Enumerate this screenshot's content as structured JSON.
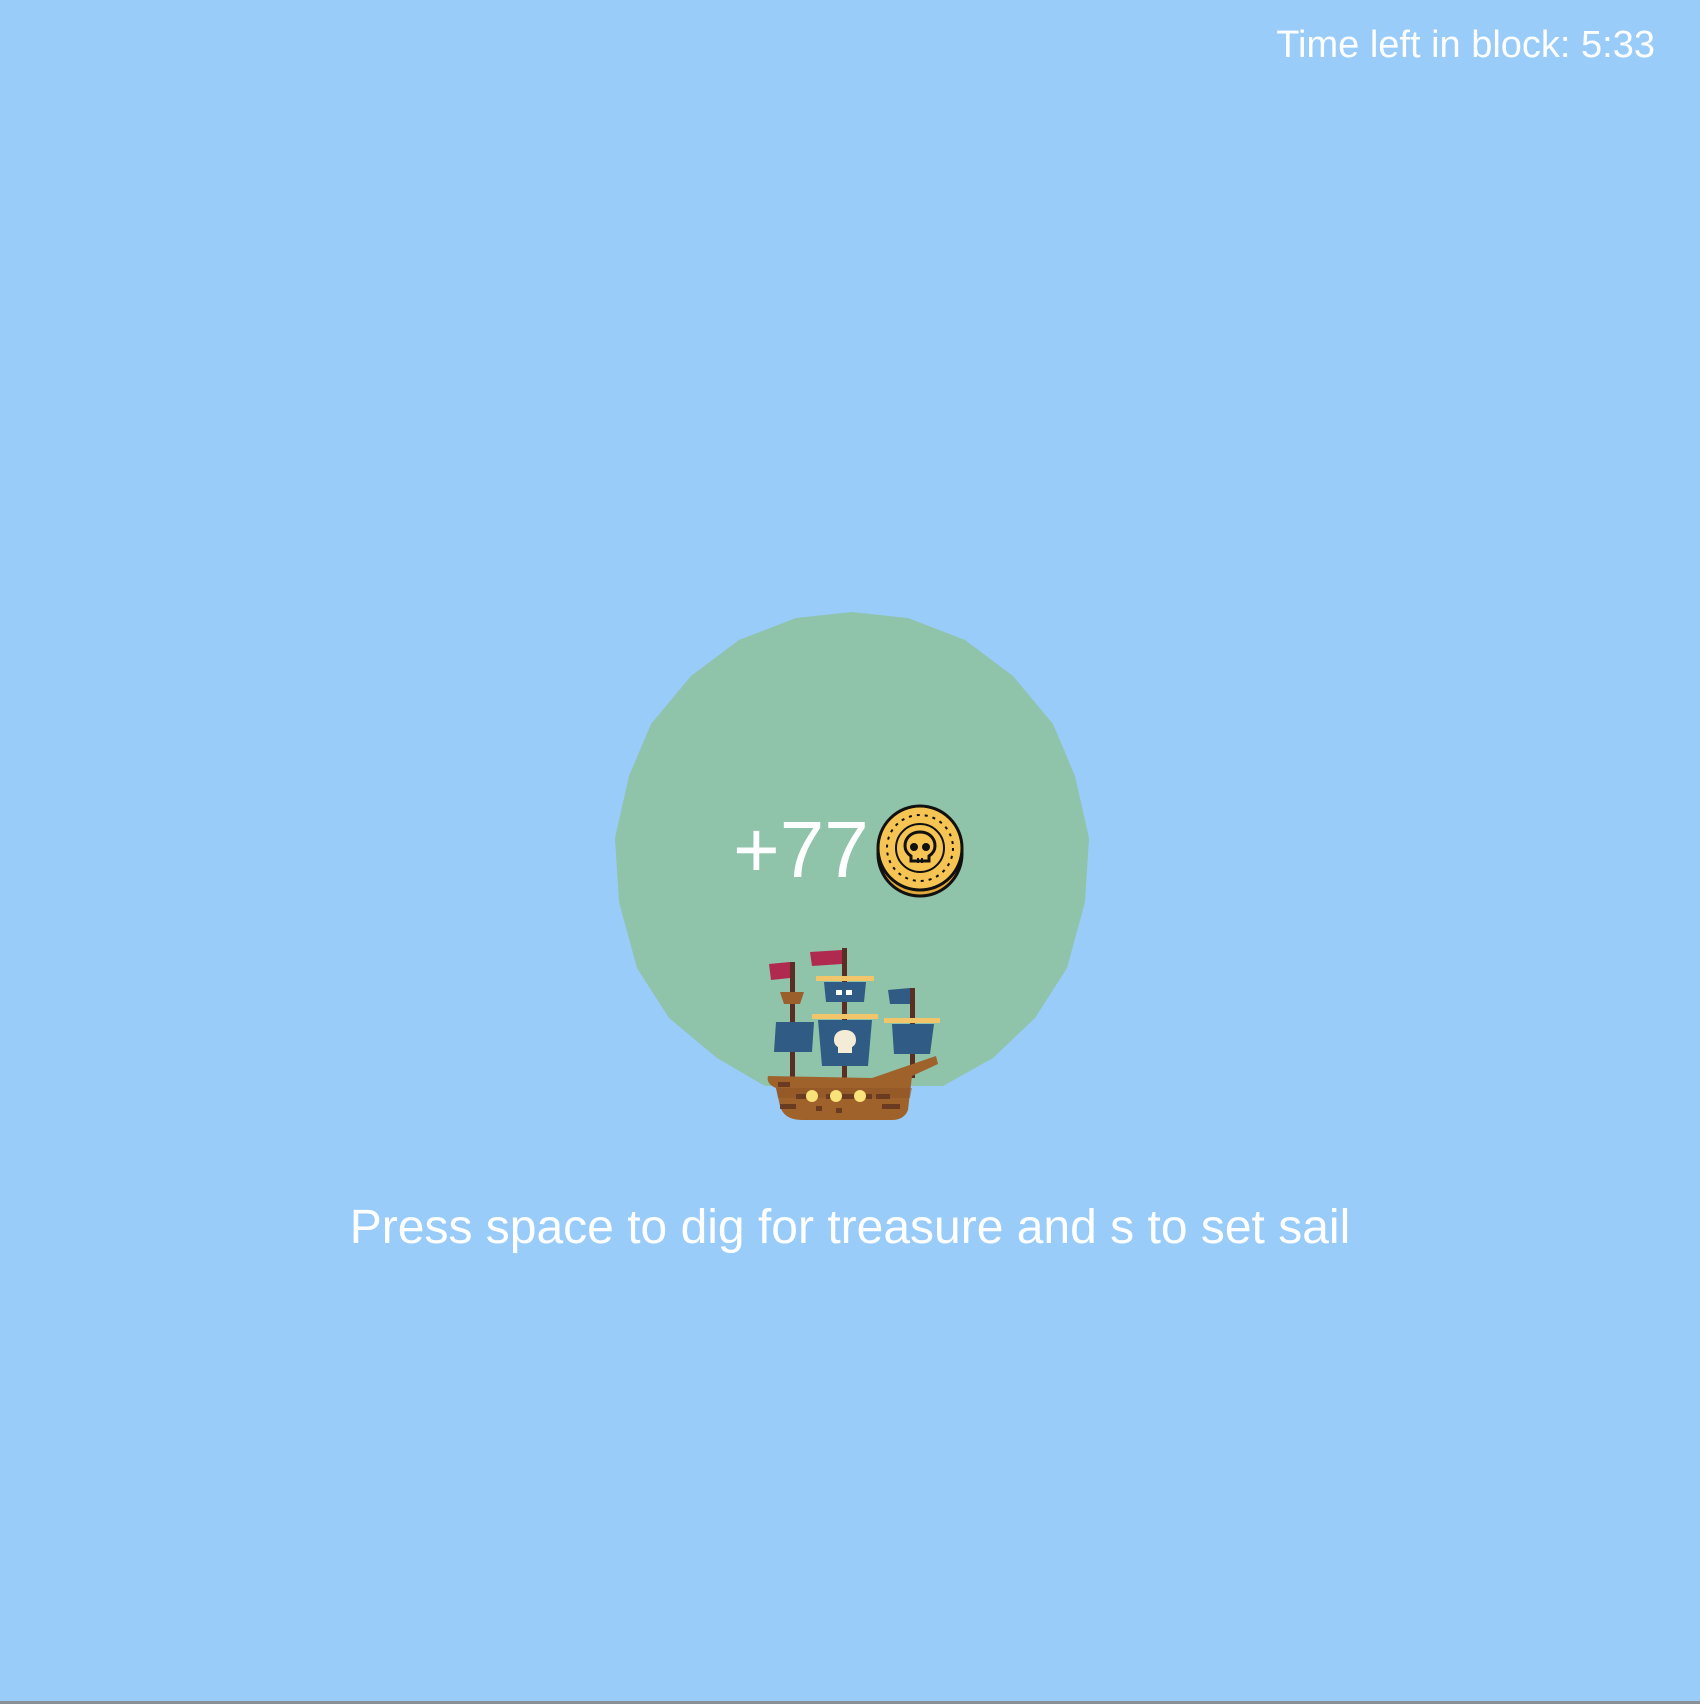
{
  "hud": {
    "time_left": "Time left in block: 5:33"
  },
  "game": {
    "reward": "+77",
    "reward_icon": "skull-coin-icon",
    "player_icon": "pirate-ship-icon",
    "island_color": "#8fc3aa",
    "ocean_color": "#99ccf9"
  },
  "instructions": {
    "text": "Press space to dig for treasure and s to set sail"
  }
}
